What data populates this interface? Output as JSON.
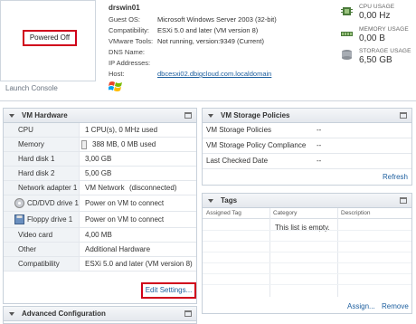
{
  "summary": {
    "vm_name": "drswin01",
    "power_state": "Powered Off",
    "launch_console": "Launch Console",
    "info": [
      {
        "label": "Guest OS:",
        "value": "Microsoft Windows Server 2003 (32-bit)"
      },
      {
        "label": "Compatibility:",
        "value": "ESXi 5.0 and later (VM version 8)"
      },
      {
        "label": "VMware Tools:",
        "value": "Not running, version:9349 (Current)"
      },
      {
        "label": "DNS Name:",
        "value": ""
      },
      {
        "label": "IP Addresses:",
        "value": ""
      },
      {
        "label": "Host:",
        "value": "dbcesxi02.dbigcloud.com.localdomain"
      }
    ],
    "usage": [
      {
        "label": "CPU USAGE",
        "value": "0,00 Hz",
        "icon": "cpu-icon"
      },
      {
        "label": "MEMORY USAGE",
        "value": "0,00 B",
        "icon": "memory-icon"
      },
      {
        "label": "STORAGE USAGE",
        "value": "6,50 GB",
        "icon": "storage-icon"
      }
    ]
  },
  "vm_hardware": {
    "title": "VM Hardware",
    "rows": [
      {
        "label": "CPU",
        "value": "1 CPU(s), 0 MHz used"
      },
      {
        "label": "Memory",
        "value": "388 MB, 0 MB used"
      },
      {
        "label": "Hard disk 1",
        "value": "3,00 GB"
      },
      {
        "label": "Hard disk 2",
        "value": "5,00 GB"
      },
      {
        "label": "Network adapter 1",
        "value": "VM Network",
        "extra": "(disconnected)"
      },
      {
        "label": "CD/DVD drive 1",
        "value": "Power on VM to connect"
      },
      {
        "label": "Floppy drive 1",
        "value": "Power on VM to connect"
      },
      {
        "label": "Video card",
        "value": "4,00 MB"
      },
      {
        "label": "Other",
        "value": "Additional Hardware"
      },
      {
        "label": "Compatibility",
        "value": "ESXi 5.0 and later (VM version 8)"
      }
    ],
    "edit_settings": "Edit Settings..."
  },
  "advanced_configuration": {
    "title": "Advanced Configuration"
  },
  "storage_policies": {
    "title": "VM Storage Policies",
    "rows": [
      {
        "label": "VM Storage Policies",
        "value": "--"
      },
      {
        "label": "VM Storage Policy Compliance",
        "value": "--"
      },
      {
        "label": "Last Checked Date",
        "value": "--"
      }
    ],
    "refresh": "Refresh"
  },
  "tags": {
    "title": "Tags",
    "columns": [
      "Assigned Tag",
      "Category",
      "Description"
    ],
    "empty_text": "This list is empty.",
    "assign": "Assign...",
    "remove": "Remove"
  },
  "colors": {
    "highlight": "#d0021b",
    "link": "#1c5e9e"
  }
}
